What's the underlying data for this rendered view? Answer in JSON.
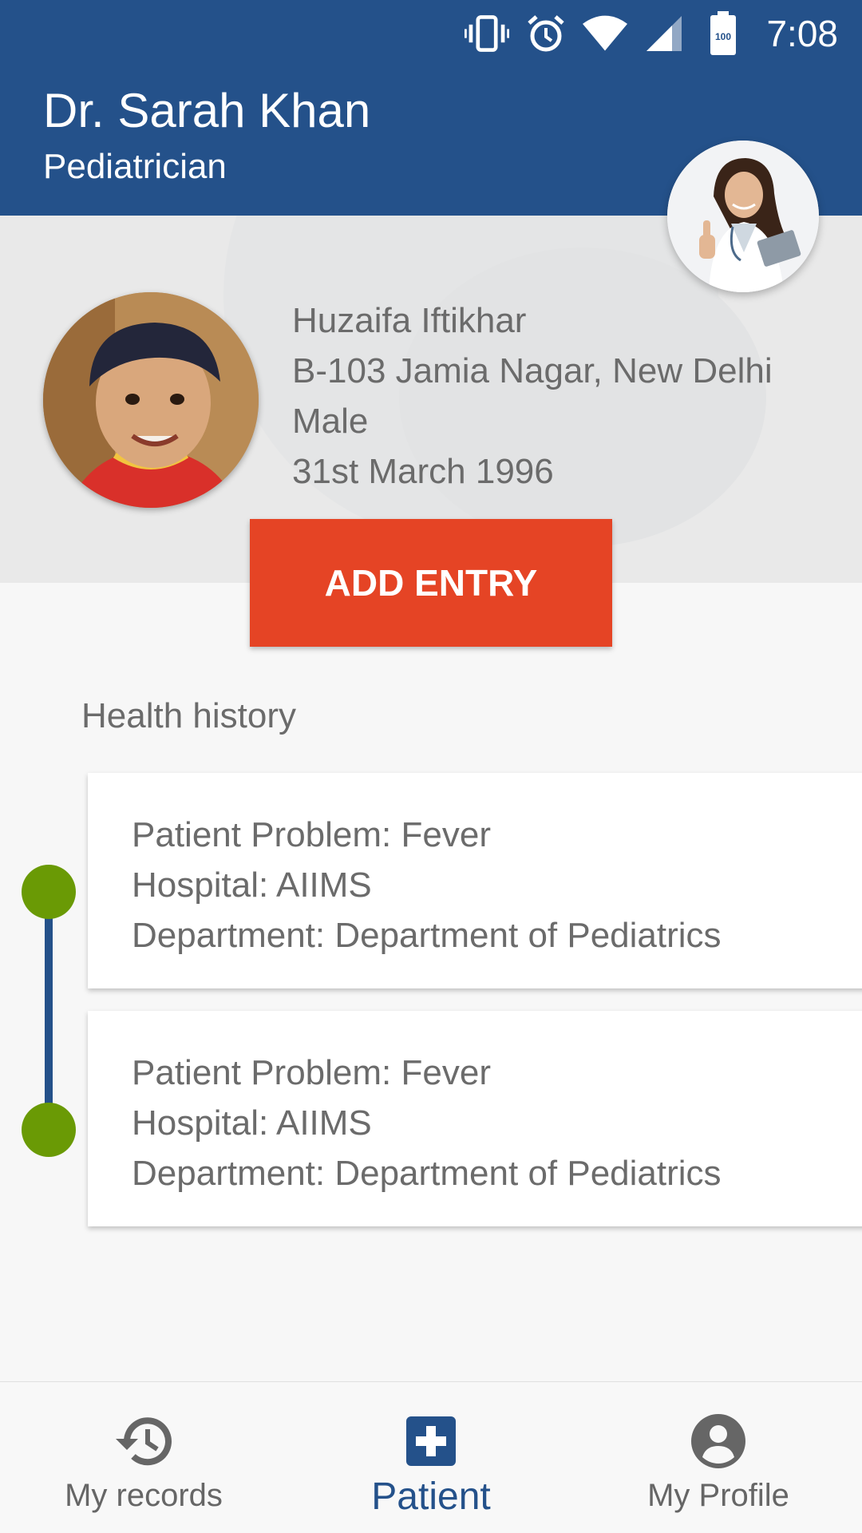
{
  "status_bar": {
    "time": "7:08",
    "battery_level": "100",
    "icons": [
      "vibrate-icon",
      "alarm-icon",
      "wifi-icon",
      "cell-signal-icon",
      "battery-icon"
    ]
  },
  "header": {
    "doctor_name": "Dr. Sarah Khan",
    "specialty": "Pediatrician",
    "background_color": "#24518a"
  },
  "patient": {
    "name": "Huzaifa Iftikhar",
    "address": "B-103 Jamia Nagar, New Delhi",
    "gender": "Male",
    "dob": "31st March 1996"
  },
  "actions": {
    "add_entry_label": "ADD ENTRY",
    "button_color": "#e54425"
  },
  "health_history": {
    "title": "Health history",
    "entries": [
      {
        "problem": "Patient Problem: Fever",
        "hospital": "Hospital: AIIMS",
        "department": "Department: Department of Pediatrics"
      },
      {
        "problem": "Patient Problem: Fever",
        "hospital": "Hospital: AIIMS",
        "department": "Department: Department of Pediatrics"
      }
    ],
    "dot_color": "#6a9a05"
  },
  "bottom_nav": {
    "items": [
      {
        "label": "My records",
        "icon": "history-icon",
        "active": false
      },
      {
        "label": "Patient",
        "icon": "medical-cross-icon",
        "active": true
      },
      {
        "label": "My Profile",
        "icon": "account-circle-icon",
        "active": false
      }
    ]
  }
}
